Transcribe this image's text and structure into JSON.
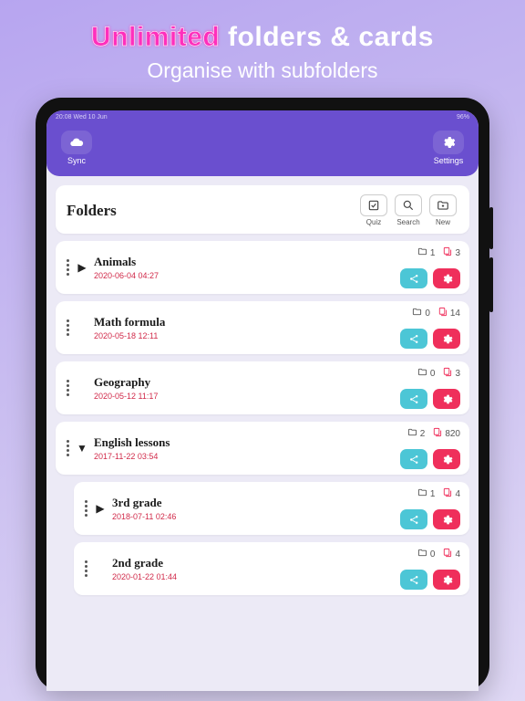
{
  "hero": {
    "accent": "Unlimited",
    "rest": " folders & cards",
    "sub": "Organise with subfolders"
  },
  "statusbar": {
    "left": "20:08  Wed 10 Jun",
    "right": "96%"
  },
  "appbar": {
    "sync": "Sync",
    "settings": "Settings"
  },
  "header": {
    "title": "Folders",
    "quiz": "Quiz",
    "search": "Search",
    "new": "New"
  },
  "folders": [
    {
      "name": "Animals",
      "date": "2020-06-04 04:27",
      "chevron": "right",
      "indent": 0,
      "folders": 1,
      "cards": 3
    },
    {
      "name": "Math formula",
      "date": "2020-05-18 12:11",
      "chevron": "",
      "indent": 0,
      "folders": 0,
      "cards": 14
    },
    {
      "name": "Geography",
      "date": "2020-05-12 11:17",
      "chevron": "",
      "indent": 0,
      "folders": 0,
      "cards": 3
    },
    {
      "name": "English lessons",
      "date": "2017-11-22 03:54",
      "chevron": "down",
      "indent": 0,
      "folders": 2,
      "cards": 820
    },
    {
      "name": "3rd grade",
      "date": "2018-07-11 02:46",
      "chevron": "right",
      "indent": 1,
      "folders": 1,
      "cards": 4
    },
    {
      "name": "2nd grade",
      "date": "2020-01-22 01:44",
      "chevron": "",
      "indent": 1,
      "folders": 0,
      "cards": 4
    }
  ]
}
